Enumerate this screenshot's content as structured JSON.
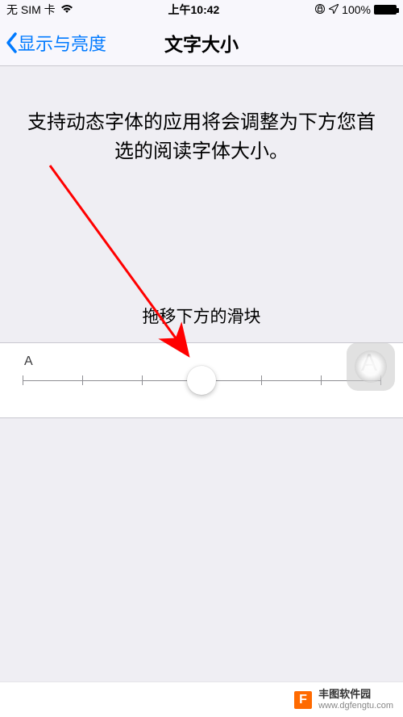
{
  "status": {
    "carrier": "无 SIM 卡",
    "time": "上午10:42",
    "battery_pct": "100%"
  },
  "nav": {
    "back_label": "显示与亮度",
    "title": "文字大小"
  },
  "content": {
    "preview_text": "支持动态字体的应用将会调整为下方您首选的阅读字体大小。",
    "instruction": "拖移下方的滑块"
  },
  "slider": {
    "small_label": "A",
    "large_label": "A",
    "ticks": 7,
    "value_index": 3
  },
  "annotation": {
    "arrow_color": "#ff0000"
  },
  "watermark": {
    "logo_letter": "F",
    "title": "丰图软件园",
    "url": "www.dgfengtu.com"
  }
}
